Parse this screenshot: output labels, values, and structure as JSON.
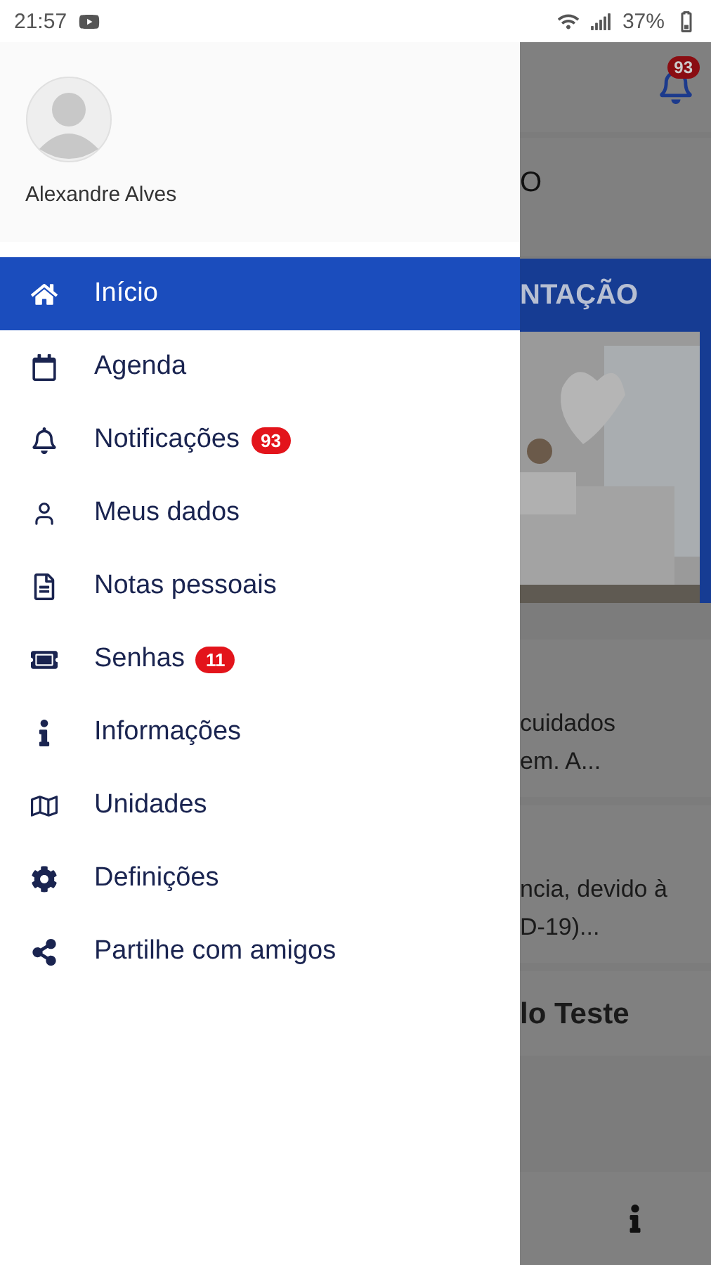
{
  "status_bar": {
    "time": "21:57",
    "battery": "37%"
  },
  "drawer": {
    "user_name": "Alexandre Alves",
    "items": [
      {
        "label": "Início",
        "kind": "home",
        "selected": true
      },
      {
        "label": "Agenda",
        "kind": "calendar",
        "selected": false
      },
      {
        "label": "Notificações",
        "kind": "bell",
        "selected": false,
        "badge": "93"
      },
      {
        "label": "Meus dados",
        "kind": "user",
        "selected": false
      },
      {
        "label": "Notas pessoais",
        "kind": "file",
        "selected": false
      },
      {
        "label": "Senhas",
        "kind": "ticket",
        "selected": false,
        "badge": "11"
      },
      {
        "label": "Informações",
        "kind": "info",
        "selected": false
      },
      {
        "label": "Unidades",
        "kind": "map",
        "selected": false
      },
      {
        "label": "Definições",
        "kind": "gear",
        "selected": false
      },
      {
        "label": "Partilhe com amigos",
        "kind": "share",
        "selected": false
      }
    ]
  },
  "background": {
    "bell_badge": "93",
    "heading": "O",
    "banner_title": "NTAÇÃO",
    "cards": [
      {
        "lines": [
          "cuidados",
          "em. A..."
        ]
      },
      {
        "lines": [
          "ncia, devido à",
          "D-19)..."
        ]
      }
    ],
    "title_card": "lo Teste"
  }
}
